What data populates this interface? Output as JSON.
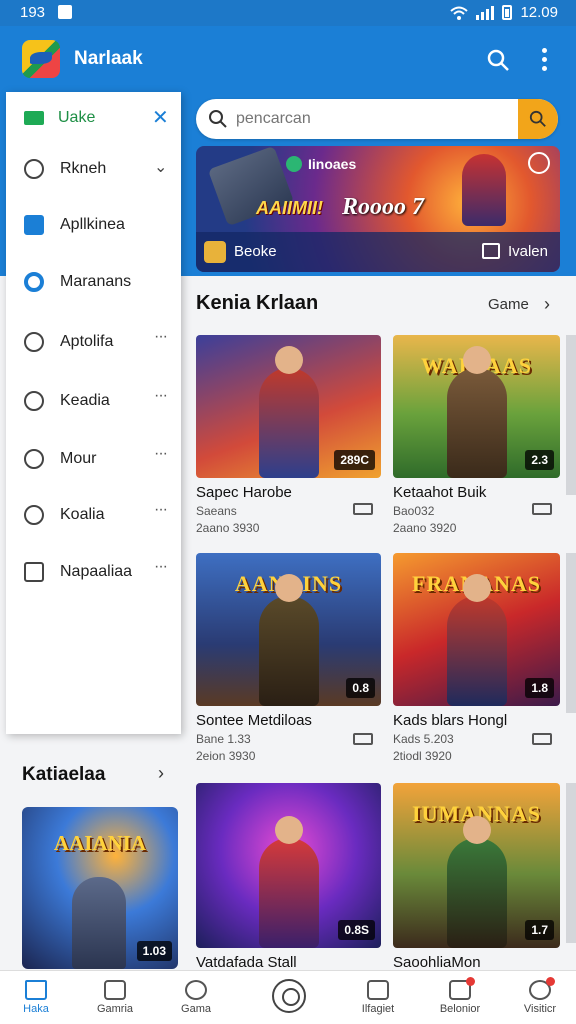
{
  "status_bar": {
    "time_left": "193",
    "time_right": "12.09"
  },
  "app_bar": {
    "title": "Narlaak"
  },
  "search": {
    "placeholder": "pencarcan"
  },
  "banner": {
    "title": "Iinoaes",
    "small_text": "AAIIMII!",
    "big_text": "Roooo 7",
    "footer_left": "Beoke",
    "footer_right": "Ivalen"
  },
  "drawer": {
    "header_label": "Uake",
    "items": [
      {
        "label": "Rkneh",
        "trailing": "chevron"
      },
      {
        "label": "Apllkinea",
        "trailing": ""
      },
      {
        "label": "Maranans",
        "trailing": ""
      },
      {
        "label": "Aptolifa",
        "trailing": "dots"
      },
      {
        "label": "Keadia",
        "trailing": "dots"
      },
      {
        "label": "Mour",
        "trailing": "dots"
      },
      {
        "label": "Koalia",
        "trailing": "dots"
      },
      {
        "label": "Napaaliaa",
        "trailing": "dots"
      }
    ]
  },
  "main": {
    "section_title": "Kenia Krlaan",
    "section_link": "Game",
    "cards": [
      {
        "name": "Sapec Harobe",
        "meta1": "Saeans",
        "meta2": "2aano 3930",
        "badge": "289C",
        "logo": ""
      },
      {
        "name": "Ketaahot Buik",
        "meta1": "Bao032",
        "meta2": "2aano 3920",
        "badge": "2.3",
        "logo": "WAINAAS"
      },
      {
        "name": "Sontee Metdiloas",
        "meta1": "Bane 1.33",
        "meta2": "2eion 3930",
        "badge": "0.8",
        "logo": "AANAINS"
      },
      {
        "name": "Kads blars Hongl",
        "meta1": "Kads 5.203",
        "meta2": "2tiodl 3920",
        "badge": "1.8",
        "logo": "FRANANAS"
      },
      {
        "name": "Vatdafada Stall",
        "meta1": "",
        "meta2": "",
        "badge": "0.8S",
        "logo": ""
      },
      {
        "name": "SaoohliaMon",
        "meta1": "",
        "meta2": "",
        "badge": "1.7",
        "logo": "IUMANNAS"
      }
    ]
  },
  "lower_left": {
    "title": "Katiaelaa",
    "card_logo": "AAIANIA",
    "card_badge": "1.03"
  },
  "bottom_nav": {
    "items": [
      {
        "label": "Haka",
        "active": true
      },
      {
        "label": "Gamria",
        "active": false
      },
      {
        "label": "Gama",
        "active": false
      },
      {
        "label": "Ilfagiet",
        "active": false
      },
      {
        "label": "Belonior",
        "active": false
      },
      {
        "label": "Visiticr",
        "active": false
      }
    ]
  },
  "colors": {
    "primary": "#1b7fd6",
    "accent": "#f2a51a",
    "drawer_header": "#1e8f45",
    "notification": "#e53935"
  },
  "icons": [
    "menu-icon",
    "search-icon",
    "more-icon",
    "close-icon",
    "shield-icon",
    "home-icon",
    "notification-icon"
  ]
}
